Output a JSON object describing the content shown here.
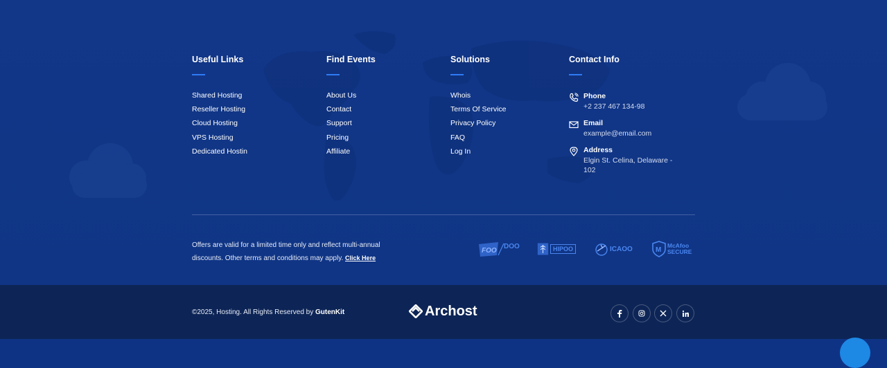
{
  "footer": {
    "columns": [
      {
        "title": "Useful Links",
        "links": [
          "Shared Hosting",
          "Reseller Hosting",
          "Cloud Hosting",
          "VPS Hosting",
          "Dedicated Hostin"
        ]
      },
      {
        "title": "Find Events",
        "links": [
          "About Us",
          "Contact",
          "Support",
          "Pricing",
          "Affiliate"
        ]
      },
      {
        "title": "Solutions",
        "links": [
          "Whois",
          "Terms Of Service",
          "Privacy Policy",
          "FAQ",
          "Log In"
        ]
      }
    ],
    "contact": {
      "title": "Contact Info",
      "phone_label": "Phone",
      "phone_value": "+2 237 467 134-98",
      "email_label": "Email",
      "email_value": "example@email.com",
      "address_label": "Address",
      "address_value": "Elgin St. Celina, Delaware - 102"
    },
    "offer_text": "Offers are valid for a limited time only and reflect multi-annual discounts. Other terms and conditions may apply.",
    "offer_link": "Click Here",
    "badges": [
      {
        "name": "DOO",
        "icon": "foo-doo-logo"
      },
      {
        "name": "HIPOO",
        "icon": "hipoo-logo"
      },
      {
        "name": "ICAOO",
        "icon": "icaoo-logo"
      },
      {
        "name": "McAfoo SECURE",
        "icon": "mcafoo-secure-logo"
      }
    ],
    "copyright_text": "©2025, Hosting. All Rights Reserved by",
    "copyright_brand": "GutenKit",
    "logo_text": "Archost",
    "social": [
      "facebook-icon",
      "instagram-icon",
      "x-icon",
      "linkedin-icon"
    ],
    "colors": {
      "background": "#123788",
      "bottom_bar": "#0d2556",
      "accent": "#2f7bf5",
      "badge_blue": "#4a86f0"
    }
  }
}
